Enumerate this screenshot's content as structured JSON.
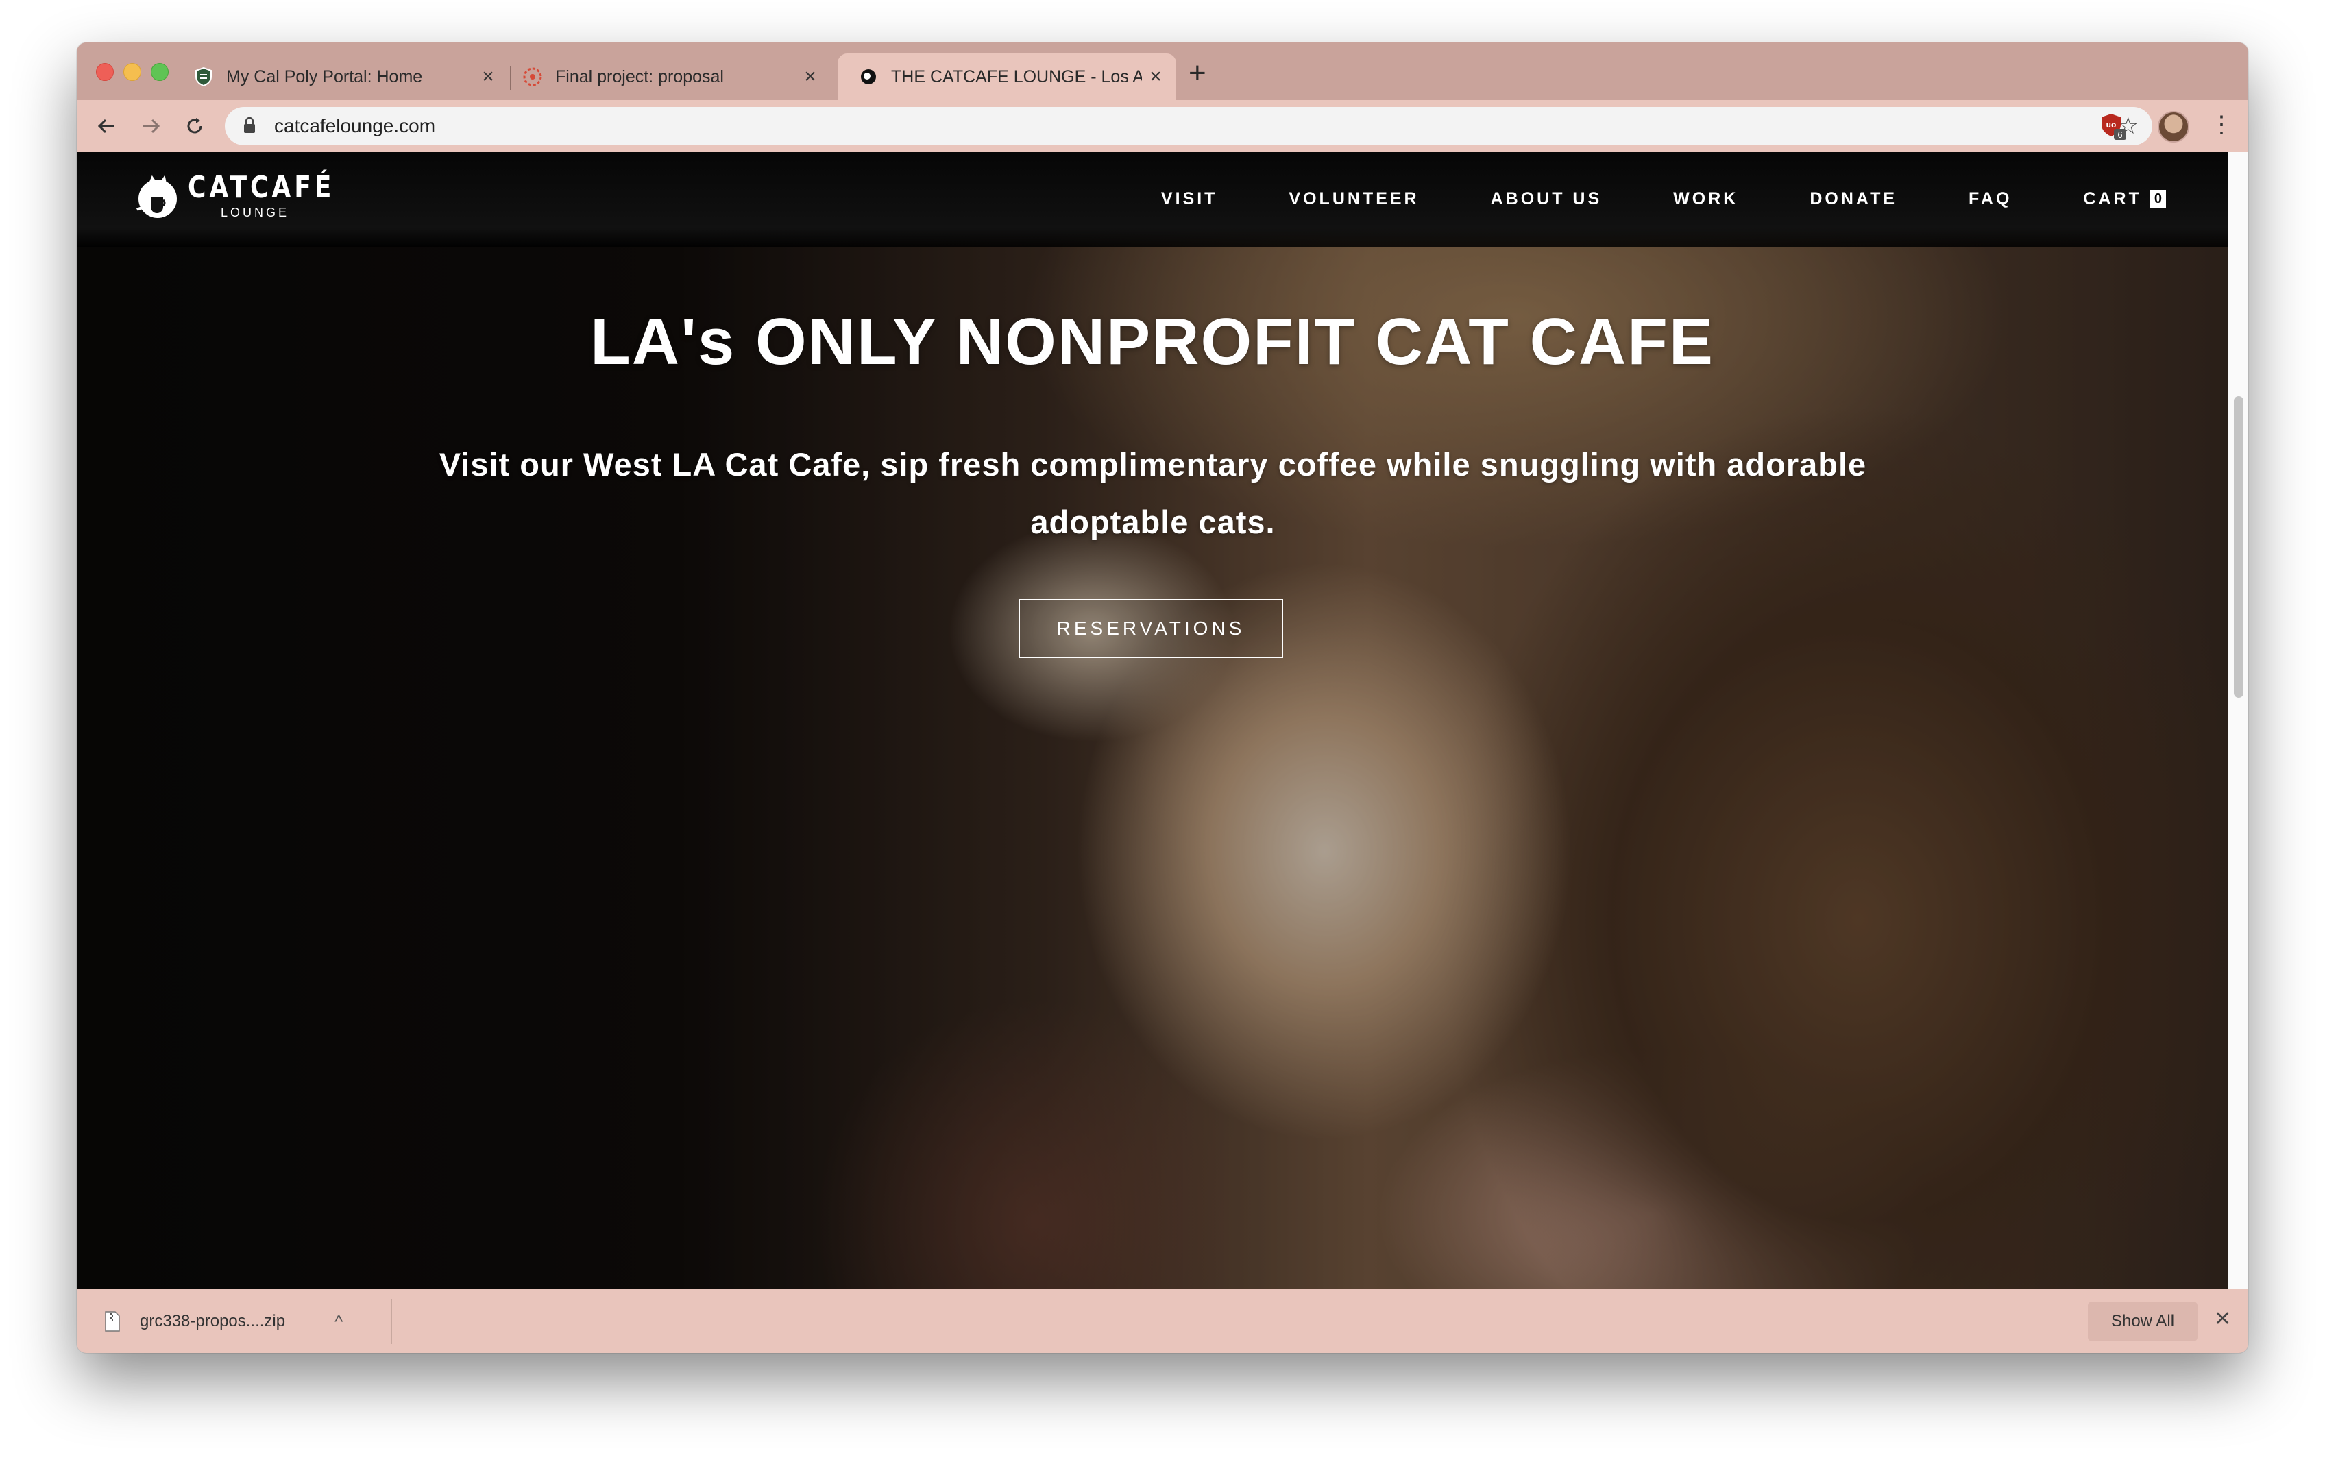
{
  "browser": {
    "tabs": [
      {
        "title": "My Cal Poly Portal: Home",
        "favicon": "shield-favicon"
      },
      {
        "title": "Final project: proposal",
        "favicon": "canvas-favicon"
      },
      {
        "title": "THE CATCAFE LOUNGE - Los A",
        "favicon": "catcafe-favicon"
      }
    ],
    "address_bar": {
      "url": "catcafelounge.com"
    },
    "extension_badge": "6",
    "colors": {
      "frame": "#c9a39b",
      "toolbar": "#e9c5bc"
    }
  },
  "site": {
    "logo": {
      "main": "CATCAFÉ",
      "sub": "LOUNGE"
    },
    "nav": [
      "VISIT",
      "VOLUNTEER",
      "ABOUT US",
      "WORK",
      "DONATE",
      "FAQ"
    ],
    "cart": {
      "label": "CART",
      "count": "0"
    },
    "hero": {
      "title": "LA's ONLY NONPROFIT CAT CAFE",
      "subtitle": "Visit our West LA Cat Cafe, sip fresh complimentary coffee while snuggling with adorable adoptable cats.",
      "cta": "RESERVATIONS"
    }
  },
  "downloads": {
    "file": "grc338-propos....zip",
    "show_all": "Show All"
  }
}
